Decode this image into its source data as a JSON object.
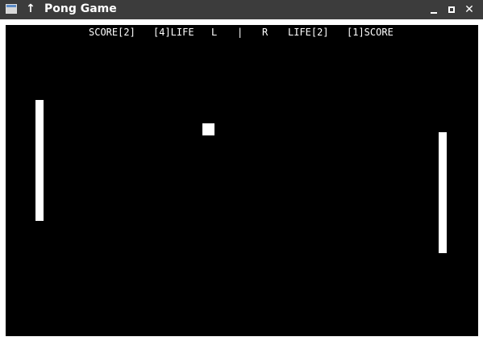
{
  "window": {
    "title": "Pong Game",
    "app_icon": "window-icon",
    "up_icon": "↑",
    "buttons": {
      "minimize_icon": "minimize-icon",
      "maximize_icon": "maximize-icon",
      "close_label": "✕"
    }
  },
  "hud": {
    "left_score": "SCORE[2]",
    "left_life": "[4]LIFE",
    "left_marker": "L",
    "divider": "|",
    "right_marker": "R",
    "right_life": "LIFE[2]",
    "right_score": "[1]SCORE"
  },
  "colors": {
    "background": "#000000",
    "foreground": "#ffffff",
    "titlebar": "#3c3c3c"
  }
}
